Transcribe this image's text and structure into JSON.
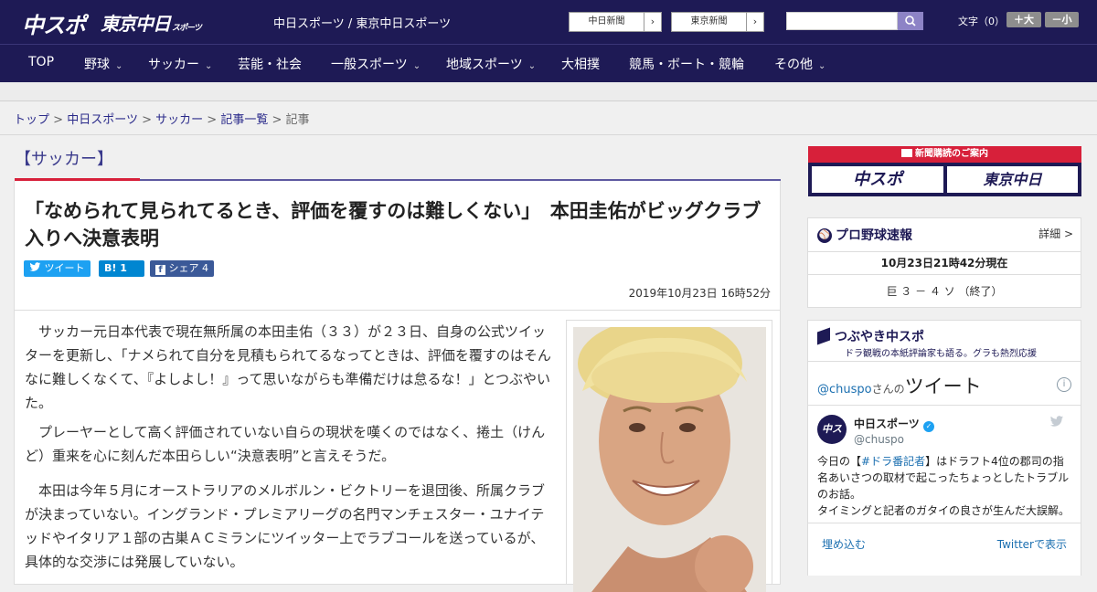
{
  "header": {
    "logo_chuspo": "中スポ",
    "logo_tokyo": "東京中日",
    "logo_tokyo_small": "スポーツ",
    "site_title": "中日スポーツ / 東京中日スポーツ",
    "link_chunichi": "中日新聞",
    "link_tokyo": "東京新聞",
    "font_size_label": "文字（0）",
    "font_bigger": "＋大",
    "font_smaller": "－小"
  },
  "nav": {
    "top": "TOP",
    "baseball": "野球",
    "soccer": "サッカー",
    "entertainment": "芸能・社会",
    "sports": "一般スポーツ",
    "local": "地域スポーツ",
    "sumo": "大相撲",
    "racing": "競馬・ボート・競輪",
    "other": "その他"
  },
  "breadcrumb": {
    "top": "トップ",
    "chunichi": "中日スポーツ",
    "soccer": "サッカー",
    "list": "記事一覧",
    "current": "記事",
    "sep": ">"
  },
  "article": {
    "category": "【サッカー】",
    "headline": "「なめられて見られてるとき、評価を覆すのは難しくない」　本田圭佑がビッグクラブ入りへ決意表明",
    "share_tweet": "ツイート",
    "share_hatena": "B! 1",
    "share_fb": "シェア 4",
    "date": "2019年10月23日 16時52分",
    "paragraphs": [
      "　サッカー元日本代表で現在無所属の本田圭佑（３３）が２３日、自身の公式ツイッターを更新し、「ナメられて自分を見積もられてるなってときは、評価を覆すのはそんなに難しくなくて、『よしよし！』って思いながらも準備だけは怠るな！」とつぶやいた。",
      "　プレーヤーとして高く評価されていない自らの現状を嘆くのではなく、捲土（けんど）重来を心に刻んだ本田らしい“決意表明”と言えそうだ。",
      "　本田は今年５月にオーストラリアのメルボルン・ビクトリーを退団後、所属クラブが決まっていない。イングランド・プレミアリーグの名門マンチェスター・ユナイテッドやイタリア１部の古巣ＡＣミランにツイッター上でラブコールを送っているが、具体的な交渉には発展していない。"
    ]
  },
  "sidebar": {
    "ad_title": "新聞購読のご案内",
    "ad_logo_chuspo": "中スポ",
    "ad_logo_tokyo": "東京中日",
    "baseball_title": "プロ野球速報",
    "baseball_detail": "詳細 >",
    "baseball_time": "10月23日21時42分現在",
    "baseball_score": "巨 ３ － ４ ソ （終了）",
    "tsubuyaki_title": "つぶやき中スポ",
    "tsubuyaki_sub": "ドラ観戦の本紙評論家も語る。グラも熱烈応援",
    "tweets_handle": "@chuspo",
    "tweets_san": "さんの",
    "tweets_word": "ツイート",
    "tw_name": "中日スポーツ",
    "tw_user": "@chuspo",
    "tw_text1_pre": "今日の【",
    "tw_text1_tag": "#ドラ番記者",
    "tw_text1_post": "】はドラフト4位の郡司の指名あいさつの取材で起こったちょっとしたトラブルのお話。",
    "tw_text2": "タイミングと記者のガタイの良さが生んだ大誤解。",
    "embed": "埋め込む",
    "view_twitter": "Twitterで表示"
  },
  "colors": {
    "brand_navy": "#1e1a55",
    "accent_red": "#d7203a",
    "link_blue": "#2a2a8a",
    "twitter_blue": "#1da1f2",
    "hatena_blue": "#0086d1",
    "facebook_blue": "#3b5998"
  }
}
